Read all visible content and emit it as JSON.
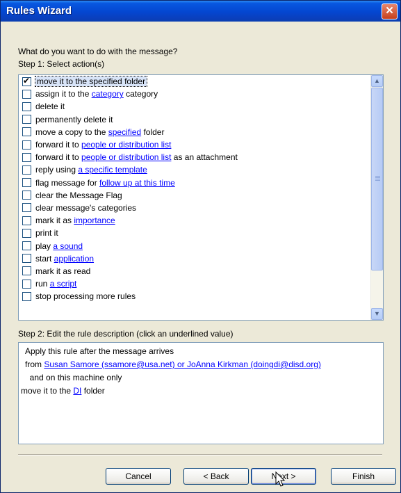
{
  "window": {
    "title": "Rules Wizard",
    "close_glyph": "✕"
  },
  "prompt": "What do you want to do with the message?",
  "step1_label": "Step 1: Select action(s)",
  "actions": [
    {
      "checked": true,
      "selected": true,
      "parts": [
        {
          "t": "move it to the specified folder"
        }
      ]
    },
    {
      "checked": false,
      "parts": [
        {
          "t": "assign it to the "
        },
        {
          "t": "category",
          "link": true
        },
        {
          "t": " category"
        }
      ]
    },
    {
      "checked": false,
      "parts": [
        {
          "t": "delete it"
        }
      ]
    },
    {
      "checked": false,
      "parts": [
        {
          "t": "permanently delete it"
        }
      ]
    },
    {
      "checked": false,
      "parts": [
        {
          "t": "move a copy to the "
        },
        {
          "t": "specified",
          "link": true
        },
        {
          "t": " folder"
        }
      ]
    },
    {
      "checked": false,
      "parts": [
        {
          "t": "forward it to "
        },
        {
          "t": "people or distribution list",
          "link": true
        }
      ]
    },
    {
      "checked": false,
      "parts": [
        {
          "t": "forward it to "
        },
        {
          "t": "people or distribution list",
          "link": true
        },
        {
          "t": " as an attachment"
        }
      ]
    },
    {
      "checked": false,
      "parts": [
        {
          "t": "reply using "
        },
        {
          "t": "a specific template",
          "link": true
        }
      ]
    },
    {
      "checked": false,
      "parts": [
        {
          "t": "flag message for "
        },
        {
          "t": "follow up at this time",
          "link": true
        }
      ]
    },
    {
      "checked": false,
      "parts": [
        {
          "t": "clear the Message Flag"
        }
      ]
    },
    {
      "checked": false,
      "parts": [
        {
          "t": "clear message's categories"
        }
      ]
    },
    {
      "checked": false,
      "parts": [
        {
          "t": "mark it as "
        },
        {
          "t": "importance",
          "link": true
        }
      ]
    },
    {
      "checked": false,
      "parts": [
        {
          "t": "print it"
        }
      ]
    },
    {
      "checked": false,
      "parts": [
        {
          "t": "play "
        },
        {
          "t": "a sound",
          "link": true
        }
      ]
    },
    {
      "checked": false,
      "parts": [
        {
          "t": "start "
        },
        {
          "t": "application",
          "link": true
        }
      ]
    },
    {
      "checked": false,
      "parts": [
        {
          "t": "mark it as read"
        }
      ]
    },
    {
      "checked": false,
      "parts": [
        {
          "t": "run "
        },
        {
          "t": "a script",
          "link": true
        }
      ]
    },
    {
      "checked": false,
      "parts": [
        {
          "t": "stop processing more rules"
        }
      ]
    }
  ],
  "step2_label": "Step 2: Edit the rule description (click an underlined value)",
  "description": [
    {
      "parts": [
        {
          "t": "Apply this rule after the message arrives"
        }
      ]
    },
    {
      "parts": [
        {
          "t": "from "
        },
        {
          "t": "Susan Samore (ssamore@usa.net) or JoAnna Kirkman (doingdi@disd.org)",
          "link": true
        }
      ]
    },
    {
      "parts": [
        {
          "t": "  and on this machine only"
        }
      ]
    },
    {
      "parts": [
        {
          "t": "move it to the "
        },
        {
          "t": "DI",
          "link": true
        },
        {
          "t": " folder"
        }
      ]
    }
  ],
  "buttons": {
    "cancel": "Cancel",
    "back": "< Back",
    "next": "Next >",
    "finish": "Finish"
  },
  "icons": {
    "scroll_up": "scroll-up-arrow-icon",
    "scroll_down": "scroll-down-arrow-icon",
    "cursor": "mouse-pointer-icon"
  },
  "colors": {
    "title_bar": "#0446d0",
    "link": "#0000ff",
    "dialog_bg": "#ece9d8",
    "close_button": "#c7401c"
  }
}
